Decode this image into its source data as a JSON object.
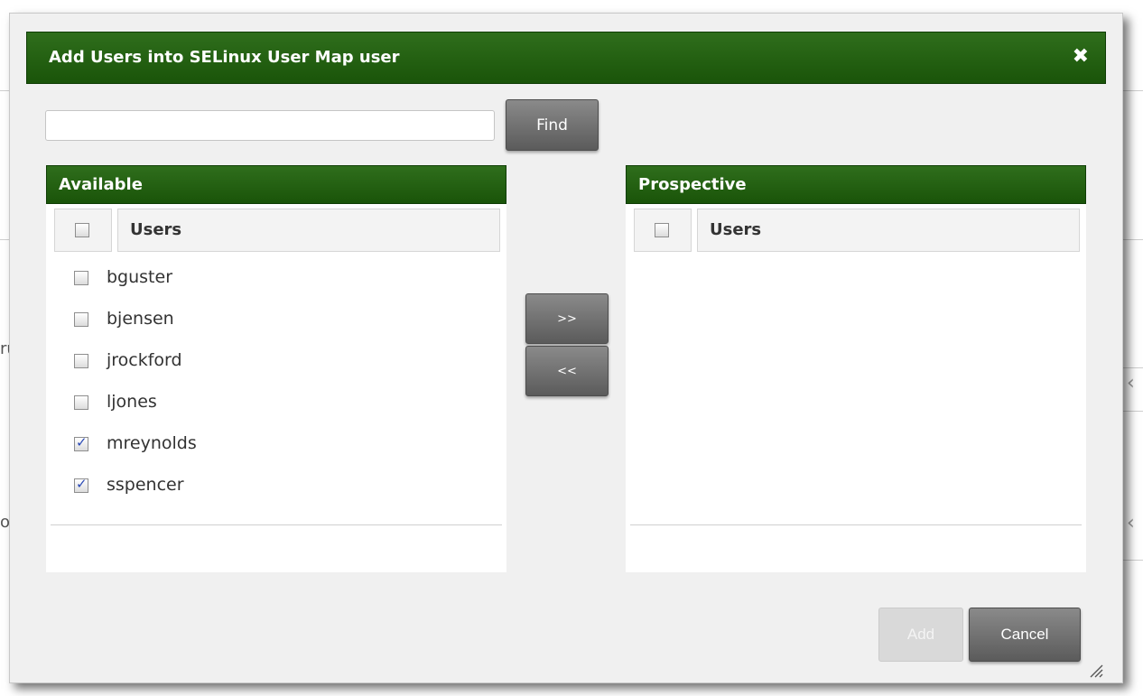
{
  "dialog": {
    "title": "Add Users into SELinux User Map user",
    "close_glyph": "✖",
    "search": {
      "value": "",
      "placeholder": ""
    },
    "find_label": "Find",
    "available": {
      "header": "Available",
      "column_label": "Users",
      "items": [
        {
          "name": "bguster",
          "checked": false
        },
        {
          "name": "bjensen",
          "checked": false
        },
        {
          "name": "jrockford",
          "checked": false
        },
        {
          "name": "ljones",
          "checked": false
        },
        {
          "name": "mreynolds",
          "checked": true
        },
        {
          "name": "sspencer",
          "checked": true
        }
      ]
    },
    "prospective": {
      "header": "Prospective",
      "column_label": "Users",
      "items": []
    },
    "move_right_label": ">>",
    "move_left_label": "<<",
    "add_label": "Add",
    "cancel_label": "Cancel"
  },
  "background": {
    "fragment_a": "ru",
    "fragment_b": "ou",
    "chevron": "‹"
  },
  "colors": {
    "header_green": "#1a5409",
    "button_gray": "#5b5b5b",
    "checkmark_blue": "#2a49b5"
  },
  "icons": [
    "close-icon",
    "checkbox-icon",
    "resize-grip-icon"
  ]
}
